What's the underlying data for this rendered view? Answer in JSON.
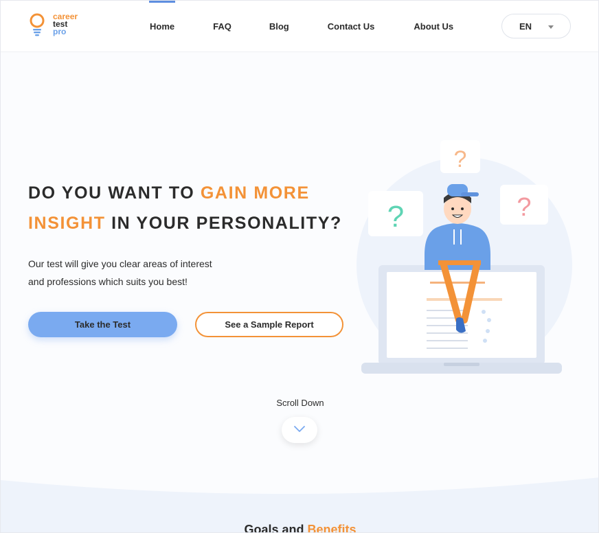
{
  "brand": {
    "line1": "career",
    "line2": "test",
    "line3": "pro",
    "colors": {
      "orange": "#f39237",
      "blue": "#6aa0e8",
      "dark": "#2b2b2b"
    }
  },
  "nav": {
    "items": [
      {
        "label": "Home",
        "active": true
      },
      {
        "label": "FAQ",
        "active": false
      },
      {
        "label": "Blog",
        "active": false
      },
      {
        "label": "Contact Us",
        "active": false
      },
      {
        "label": "About Us",
        "active": false
      }
    ],
    "language": "EN",
    "language_icon": "caret-down-icon"
  },
  "hero": {
    "headline_part1": "DO YOU WANT TO ",
    "headline_highlight1": "GAIN MORE",
    "headline_highlight2": "INSIGHT",
    "headline_part2": " IN YOUR PERSONALITY?",
    "subtext_line1": "Our test will give you clear areas of interest",
    "subtext_line2": "and professions which suits you best!",
    "primary_button": "Take the Test",
    "secondary_button": "See a Sample Report",
    "illustration_marks": [
      "?",
      "?",
      "?"
    ]
  },
  "scroll": {
    "label": "Scroll Down",
    "icon": "chevron-down-icon"
  },
  "goals": {
    "title_part1": "Goals and ",
    "title_highlight": "Benefits"
  }
}
